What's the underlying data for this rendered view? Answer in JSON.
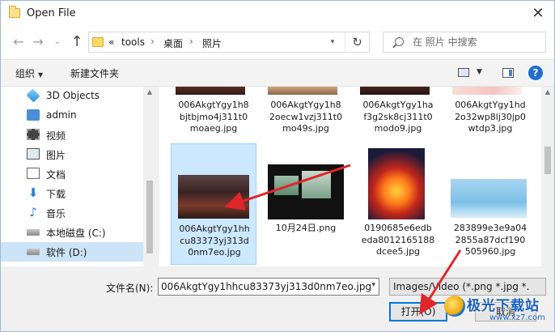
{
  "window": {
    "title": "Open File",
    "close": "✕"
  },
  "nav": {
    "back": "←",
    "forward": "→",
    "recent": "⌄",
    "up": "↑",
    "breadcrumb_prefix": "«",
    "breadcrumbs": [
      "tools",
      "桌面",
      "照片"
    ],
    "separator": "›",
    "refresh": "↻",
    "search_placeholder": "在 照片 中搜索"
  },
  "toolbar": {
    "organize": "组织",
    "new_folder": "新建文件夹",
    "help": "?"
  },
  "sidebar": {
    "items": [
      {
        "label": "3D Objects",
        "icon": "cube-icon"
      },
      {
        "label": "admin",
        "icon": "user-folder-icon"
      },
      {
        "label": "视频",
        "icon": "video-icon"
      },
      {
        "label": "图片",
        "icon": "picture-icon"
      },
      {
        "label": "文档",
        "icon": "document-icon"
      },
      {
        "label": "下载",
        "icon": "download-icon"
      },
      {
        "label": "音乐",
        "icon": "music-icon"
      },
      {
        "label": "本地磁盘 (C:)",
        "icon": "drive-icon"
      },
      {
        "label": "软件 (D:)",
        "icon": "drive-icon"
      }
    ],
    "selected_index": 8
  },
  "files": {
    "top_row": [
      {
        "name": "006AkgtYgy1h8bjtbjmo4j311t0moaeg.jpg",
        "lines": [
          "006AkgtYgy1h8",
          "bjtbjmo4j311t0",
          "moaeg.jpg"
        ]
      },
      {
        "name": "006AkgtYgy1h82oecw1vzj311t0mo49s.jpg",
        "lines": [
          "006AkgtYgy1h8",
          "2oecw1vzj311t0",
          "mo49s.jpg"
        ]
      },
      {
        "name": "006AkgtYgy1haf3g2sk8cj311t0modo9.jpg",
        "lines": [
          "006AkgtYgy1ha",
          "f3g2sk8cj311t0",
          "modo9.jpg"
        ]
      },
      {
        "name": "006AkgtYgy1hd2o32wp8lj30jp0wtdp3.jpg",
        "lines": [
          "006AkgtYgy1hd",
          "2o32wp8lj30jp0",
          "wtdp3.jpg"
        ]
      }
    ],
    "bottom_row": [
      {
        "name": "006AkgtYgy1hhcu83373yj313d0nm7eo.jpg",
        "lines": [
          "006AkgtYgy1hh",
          "cu83373yj313d",
          "0nm7eo.jpg"
        ],
        "selected": true
      },
      {
        "name": "10月24日.png",
        "lines": [
          "10月24日.png"
        ]
      },
      {
        "name": "0190685e6edbeda8012165188dcee5.jpg",
        "lines": [
          "0190685e6edb",
          "eda8012165188",
          "dcee5.jpg"
        ]
      },
      {
        "name": "283899e3e9a042855a87dcf190505960.jpg",
        "lines": [
          "283899e3e9a04",
          "2855a87dcf190",
          "505960.jpg"
        ]
      }
    ]
  },
  "bottom": {
    "filename_label": "文件名(N):",
    "filename_value": "006AkgtYgy1hhcu83373yj313d0nm7eo.jpg",
    "filter_value": "Images/Video (*.png *.jpg *.",
    "open_label": "打开(O)",
    "cancel_label": "取消"
  },
  "watermark": {
    "text": "极光下载站",
    "sub": "www.xz7.com"
  },
  "colors": {
    "selection": "#cce8ff",
    "accent": "#0078d7",
    "annotation_arrow": "#e0262a"
  }
}
